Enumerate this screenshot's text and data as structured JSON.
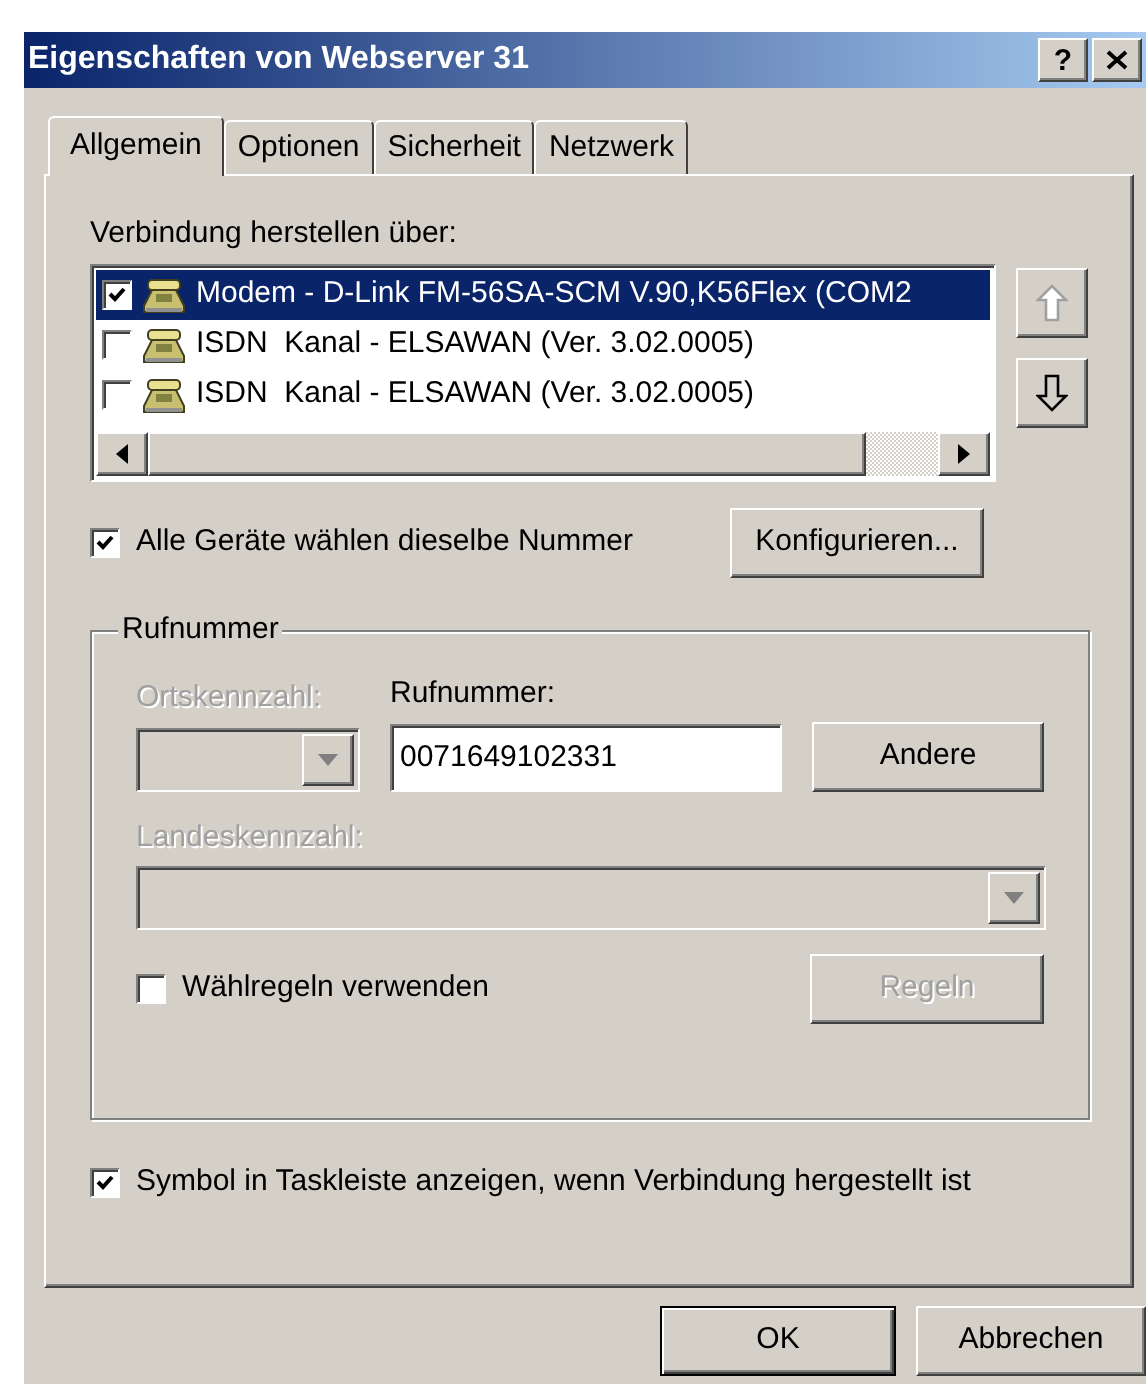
{
  "window": {
    "title": "Eigenschaften von Webserver 31",
    "buttons": [
      {
        "kind": "help",
        "label": "?"
      },
      {
        "kind": "close"
      }
    ]
  },
  "tabs": [
    {
      "label": "Allgemein",
      "selected": true
    },
    {
      "label": "Optionen",
      "selected": false
    },
    {
      "label": "Sicherheit",
      "selected": false
    },
    {
      "label": "Netzwerk",
      "selected": false
    }
  ],
  "connection": {
    "label": "Verbindung herstellen über:",
    "devices": [
      {
        "label": "Modem - D-Link FM-56SA-SCM V.90,K56Flex (COM2",
        "checked": true,
        "selected": true
      },
      {
        "label": "ISDN  Kanal - ELSAWAN (Ver. 3.02.0005)",
        "checked": false,
        "selected": false
      },
      {
        "label": "ISDN  Kanal - ELSAWAN (Ver. 3.02.0005)",
        "checked": false,
        "selected": false
      }
    ],
    "move_buttons": [
      {
        "kind": "up",
        "disabled": true
      },
      {
        "kind": "down",
        "disabled": false
      }
    ]
  },
  "same_number": {
    "label": "Alle Geräte wählen dieselbe Nummer",
    "checked": true
  },
  "configure_button": {
    "label": "Konfigurieren..."
  },
  "phone_group": {
    "title": "Rufnummer",
    "area_code": {
      "label": "Ortskennzahl:",
      "disabled": true
    },
    "number": {
      "label": "Rufnummer:",
      "value": "0071649102331"
    },
    "other_button": {
      "label": "Andere"
    },
    "country_code": {
      "label": "Landeskennzahl:",
      "disabled": true
    },
    "dialing_rules": {
      "label": "Wählregeln verwenden",
      "checked": false
    },
    "rules_button": {
      "label": "Regeln",
      "disabled": true
    }
  },
  "taskbar_icon": {
    "label": "Symbol in Taskleiste anzeigen, wenn Verbindung hergestellt ist",
    "checked": true
  },
  "buttons": [
    {
      "label": "OK",
      "default": true
    },
    {
      "label": "Abbrechen",
      "default": false
    }
  ]
}
